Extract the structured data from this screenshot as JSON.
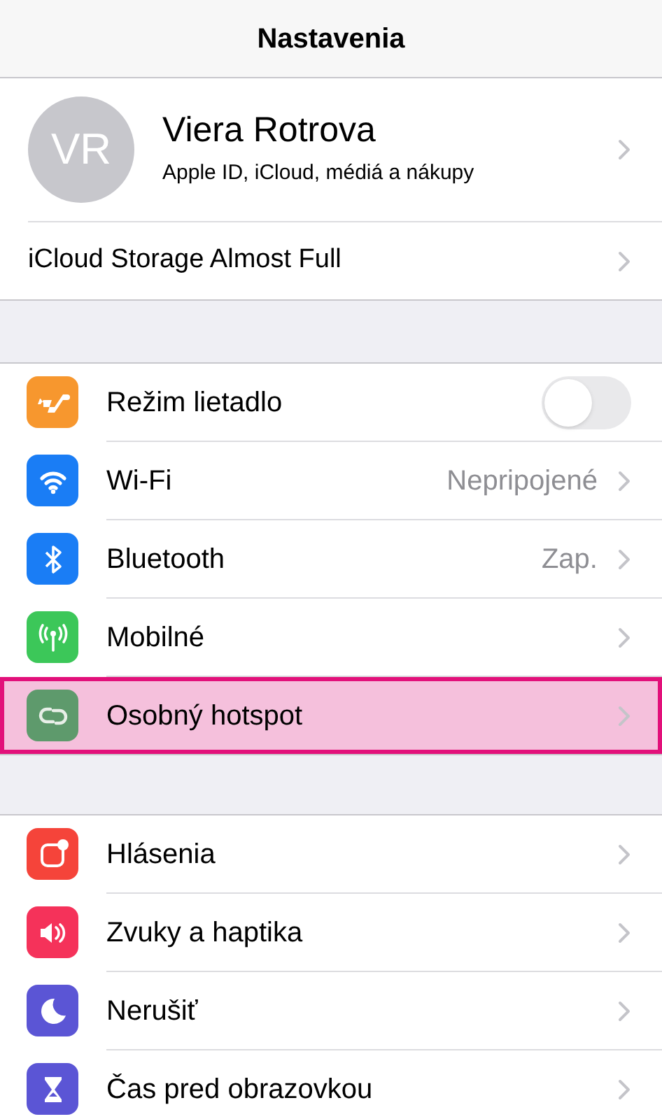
{
  "nav_bar": {
    "title": "Nastavenia"
  },
  "profile": {
    "initials": "VR",
    "name": "Viera Rotrova",
    "subtitle": "Apple ID, iCloud, médiá a nákupy"
  },
  "storage_alert": {
    "label": "iCloud Storage Almost Full"
  },
  "sections": [
    {
      "items": [
        {
          "label": "Režim lietadlo",
          "kind": "toggle",
          "on": false,
          "color": "#f7972e",
          "highlighted": false
        },
        {
          "label": "Wi-Fi",
          "kind": "link",
          "detail": "Nepripojené",
          "color": "#1a7df5",
          "highlighted": false
        },
        {
          "label": "Bluetooth",
          "kind": "link",
          "detail": "Zap.",
          "color": "#1a7df5",
          "highlighted": false
        },
        {
          "label": "Mobilné",
          "kind": "link",
          "color": "#3cc759",
          "highlighted": false
        },
        {
          "label": "Osobný hotspot",
          "kind": "link",
          "color": "#5e9a6c",
          "highlighted": true
        }
      ]
    },
    {
      "items": [
        {
          "label": "Hlásenia",
          "kind": "link",
          "color": "#f5443a",
          "highlighted": false
        },
        {
          "label": "Zvuky a haptika",
          "kind": "link",
          "color": "#f5325a",
          "highlighted": false
        },
        {
          "label": "Nerušiť",
          "kind": "link",
          "color": "#5b55d5",
          "highlighted": false
        },
        {
          "label": "Čas pred obrazovkou",
          "kind": "link",
          "color": "#5b55d5",
          "highlighted": false
        }
      ]
    }
  ]
}
